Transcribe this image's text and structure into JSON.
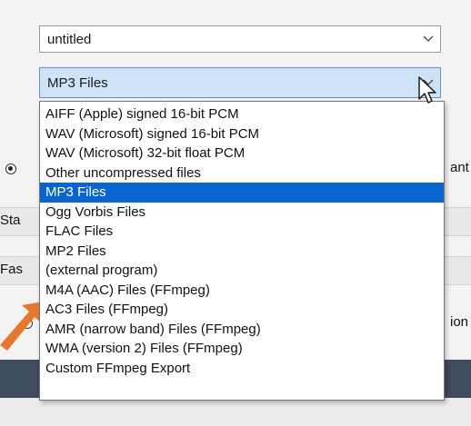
{
  "name_field": {
    "value": "untitled"
  },
  "type_field": {
    "value": "MP3 Files"
  },
  "background": {
    "left_labels": [
      "Sta",
      "Fas"
    ],
    "right_fragments": [
      "ant",
      "ion"
    ],
    "radio_fragment_1": "O",
    "radio_fragment_2": "J"
  },
  "file_types": [
    "AIFF (Apple) signed 16-bit PCM",
    "WAV (Microsoft) signed 16-bit PCM",
    "WAV (Microsoft) 32-bit float PCM",
    "Other uncompressed files",
    "MP3 Files",
    "Ogg Vorbis Files",
    "FLAC Files",
    "MP2 Files",
    "(external program)",
    "M4A (AAC) Files (FFmpeg)",
    "AC3 Files (FFmpeg)",
    "AMR (narrow band) Files (FFmpeg)",
    "WMA (version 2) Files (FFmpeg)",
    "Custom FFmpeg Export"
  ],
  "selected_index": 4,
  "colors": {
    "selection": "#0a64d0",
    "arrow": "#e8772e"
  }
}
